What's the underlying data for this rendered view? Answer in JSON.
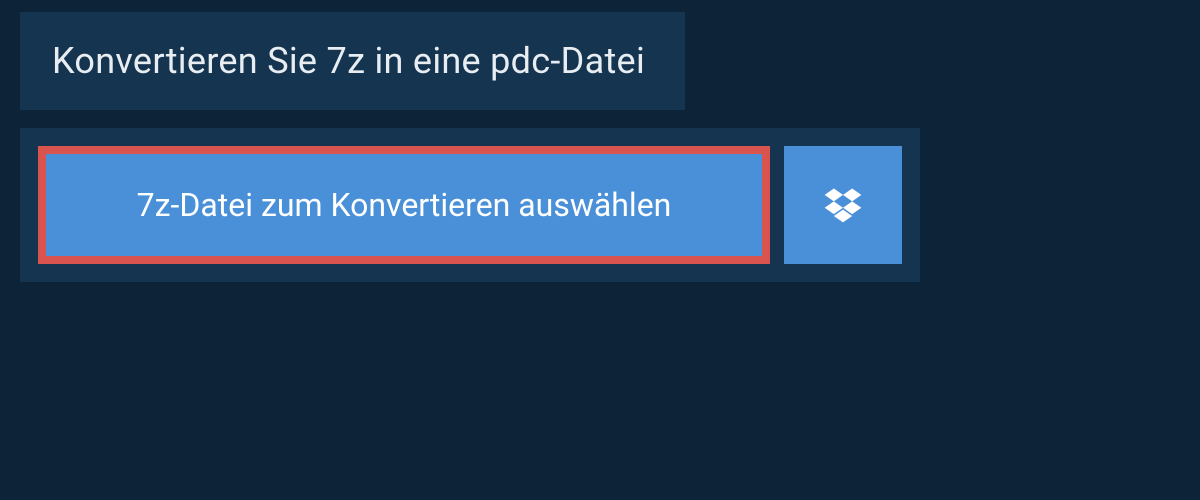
{
  "header": {
    "title": "Konvertieren Sie 7z in eine pdc-Datei"
  },
  "actions": {
    "select_file_label": "7z-Datei zum Konvertieren auswählen",
    "dropbox_icon": "dropbox-icon"
  }
}
